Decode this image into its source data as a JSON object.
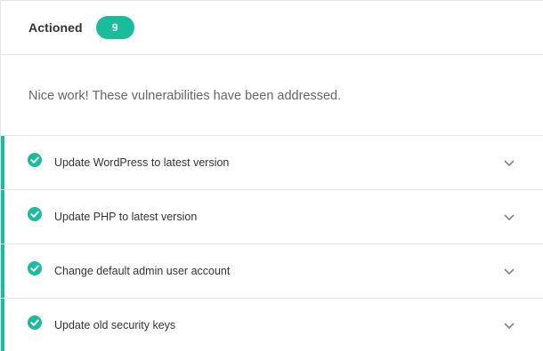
{
  "colors": {
    "accent": "#1abc9c",
    "text": "#333333",
    "muted": "#666666",
    "chevron": "#888888"
  },
  "header": {
    "title": "Actioned",
    "count": "9"
  },
  "message": "Nice work! These vulnerabilities have been addressed.",
  "items": [
    {
      "label": "Update WordPress to latest version",
      "status_icon": "check-circle-icon",
      "toggle_icon": "chevron-down-icon"
    },
    {
      "label": "Update PHP to latest version",
      "status_icon": "check-circle-icon",
      "toggle_icon": "chevron-down-icon"
    },
    {
      "label": "Change default admin user account",
      "status_icon": "check-circle-icon",
      "toggle_icon": "chevron-down-icon"
    },
    {
      "label": "Update old security keys",
      "status_icon": "check-circle-icon",
      "toggle_icon": "chevron-down-icon"
    }
  ]
}
